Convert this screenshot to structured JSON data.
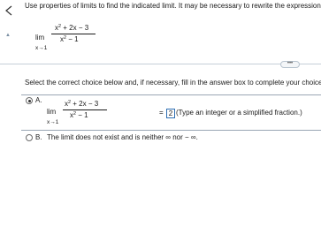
{
  "prompt": "Use properties of limits to find the indicated limit. It may be necessary to rewrite the expression bef",
  "problem": {
    "lim": "lim",
    "sub": "x→1",
    "num_a": "x",
    "num_exp": "2",
    "num_b": " + 2x − 3",
    "den_a": "x",
    "den_exp": "2",
    "den_b": " − 1"
  },
  "divider": {
    "more_label": "•••"
  },
  "instruction": "Select the correct choice below and, if necessary, fill in the answer box to complete your choice.",
  "options": {
    "a": {
      "letter": "A.",
      "equals": "=",
      "answer_value": "2",
      "hint": "(Type an integer or a simplified fraction.)"
    },
    "b": {
      "letter": "B.",
      "text": "The limit does not exist and is neither ∞ nor − ∞."
    }
  },
  "icons": {
    "back": "back-arrow-icon",
    "expand": "expand-handle-icon"
  },
  "colors": {
    "accent": "#2f6fb3",
    "divider": "#c6cfd8"
  }
}
